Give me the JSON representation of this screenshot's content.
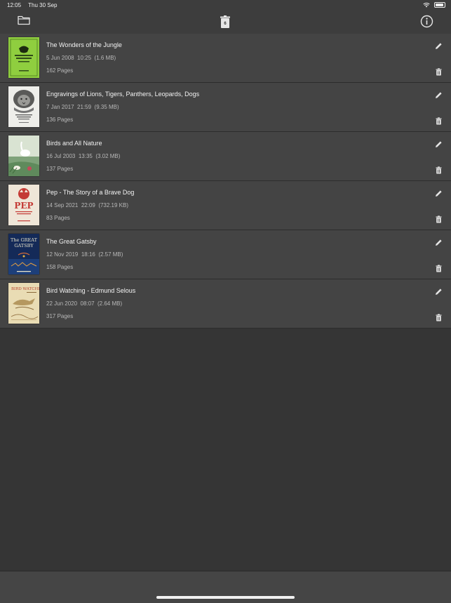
{
  "status": {
    "time": "12:05",
    "date": "Thu 30 Sep"
  },
  "toolbar": {
    "trash_count": "6",
    "folder_icon": "folder-icon",
    "trash_icon": "trash-icon",
    "info_icon": "info-icon"
  },
  "colors": {
    "background": "#353535",
    "row": "#444444",
    "bar": "#3d3d3d"
  },
  "books": [
    {
      "title": "The Wonders of the Jungle",
      "date": "5 Jun 2008",
      "time": "10:25",
      "size": "(1.6 MB)",
      "pages": "162 Pages"
    },
    {
      "title": "Engravings of Lions, Tigers, Panthers, Leopards, Dogs",
      "date": "7 Jan 2017",
      "time": "21:59",
      "size": "(9.35 MB)",
      "pages": "136 Pages"
    },
    {
      "title": "Birds and All Nature",
      "date": "16 Jul 2003",
      "time": "13:35",
      "size": "(3.02 MB)",
      "pages": "137 Pages"
    },
    {
      "title": "Pep - The Story of a Brave Dog",
      "date": "14 Sep 2021",
      "time": "22:09",
      "size": "(732.19 KB)",
      "pages": "83 Pages"
    },
    {
      "title": "The Great Gatsby",
      "date": "12 Nov 2019",
      "time": "18:16",
      "size": "(2.57 MB)",
      "pages": "158 Pages"
    },
    {
      "title": "Bird Watching - Edmund Selous",
      "date": "22 Jun 2020",
      "time": "08:07",
      "size": "(2.64 MB)",
      "pages": "317 Pages"
    }
  ]
}
